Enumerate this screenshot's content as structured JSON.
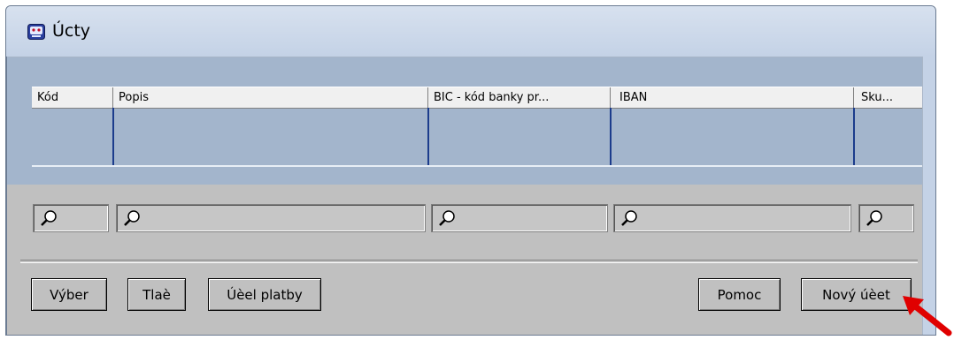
{
  "window": {
    "title": "Úcty"
  },
  "grid": {
    "columns": [
      {
        "label": "Kód"
      },
      {
        "label": "Popis"
      },
      {
        "label": "BIC - kód banky pr..."
      },
      {
        "label": "IBAN"
      },
      {
        "label": "Sku..."
      }
    ]
  },
  "buttons": {
    "vyber": "Výber",
    "tlac": "Tlaè",
    "ucel_platby": "Úèel platby",
    "pomoc": "Pomoc",
    "novy_ucet": "Nový úèet"
  },
  "icons": {
    "filter": "magnifier-icon",
    "app": "app-icon",
    "annotation": "red-arrow-icon"
  },
  "colors": {
    "grid_background": "#a3b5cc",
    "column_divider": "#1c3c8c",
    "annotation_arrow": "#e00000"
  }
}
